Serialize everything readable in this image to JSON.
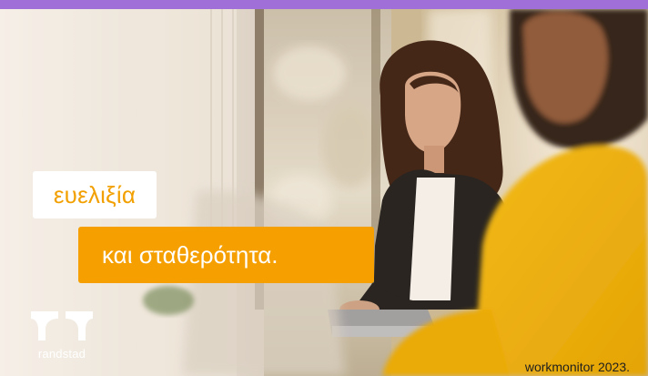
{
  "headline": {
    "line1": "ευελιξία",
    "line2": "και σταθερότητα."
  },
  "logo": {
    "name": "randstad"
  },
  "footer": {
    "caption": "workmonitor 2023."
  },
  "colors": {
    "top_bar": "#a070d8",
    "accent_orange": "#f5a000",
    "line1_text": "#f2a000",
    "tag_white": "#ffffff",
    "logo_white": "#ffffff"
  },
  "icons": {
    "logo_mark": "randstad-logo-icon"
  }
}
